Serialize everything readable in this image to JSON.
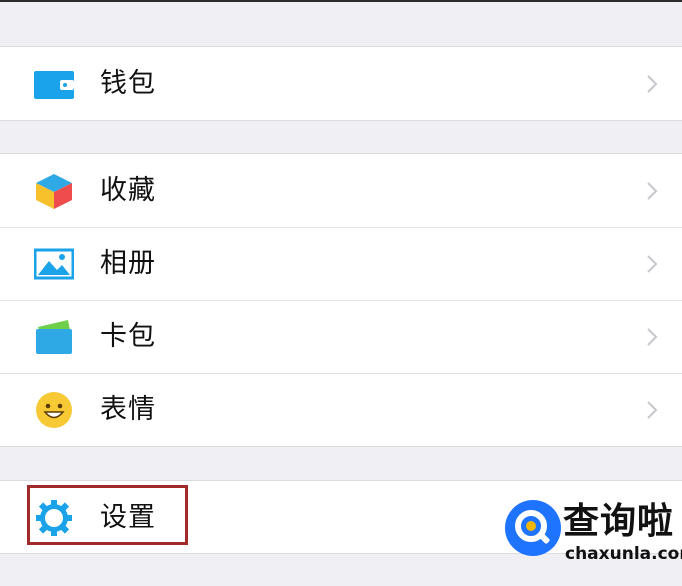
{
  "menu": {
    "groups": [
      {
        "items": [
          {
            "label": "钱包",
            "icon": "wallet-icon"
          }
        ]
      },
      {
        "items": [
          {
            "label": "收藏",
            "icon": "favorites-cube-icon"
          },
          {
            "label": "相册",
            "icon": "album-image-icon"
          },
          {
            "label": "卡包",
            "icon": "card-wallet-icon"
          },
          {
            "label": "表情",
            "icon": "smiley-face-icon"
          }
        ]
      },
      {
        "items": [
          {
            "label": "设置",
            "icon": "settings-gear-icon"
          }
        ]
      }
    ]
  },
  "watermark": {
    "title": "查询啦",
    "url": "chaxunla.com"
  },
  "colors": {
    "background": "#efeff4",
    "highlight_border": "#a32a2a",
    "accent_blue": "#1aa3e8"
  }
}
